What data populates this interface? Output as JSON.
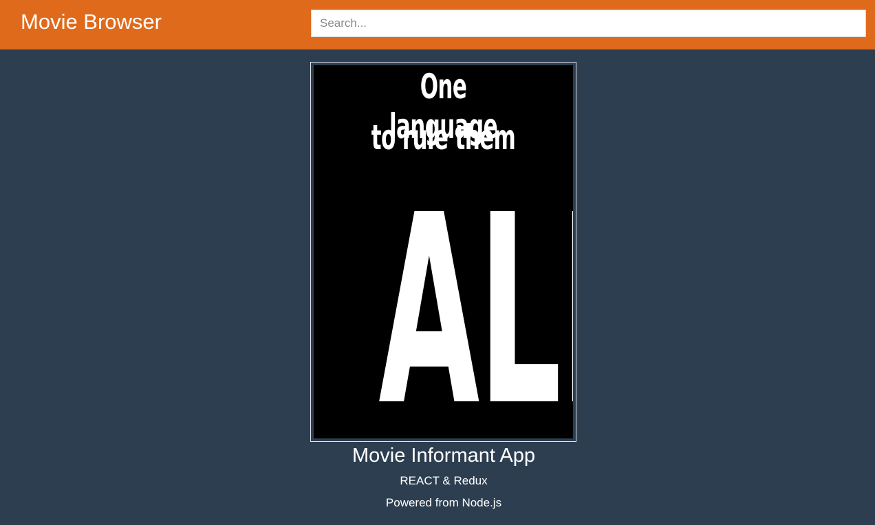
{
  "header": {
    "brand": "Movie Browser",
    "search_placeholder": "Search...",
    "search_value": ""
  },
  "poster": {
    "line1": "One language",
    "line2": "to rule them",
    "big_word": "ALL"
  },
  "main": {
    "title": "Movie Informant App",
    "subtitle": "REACT & Redux",
    "powered_by": "Powered from Node.js"
  },
  "colors": {
    "navbar": "#e06a1b",
    "background": "#2c3e50",
    "text": "#ffffff"
  }
}
